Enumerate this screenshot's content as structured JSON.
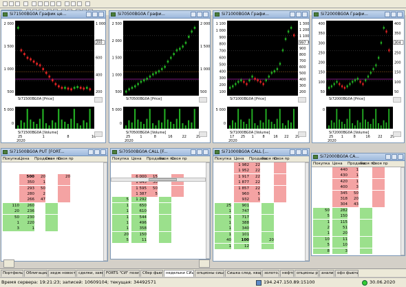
{
  "toolbar": {
    "timeframe": "M5"
  },
  "chart_windows": [
    {
      "title": "Si71500BG0A График це...",
      "price_label": "Si71500BG0A [Price]",
      "volume_label": "Si71500BG0A [Volume]",
      "price_ticks_left": [
        "2 000",
        "1 500",
        "1 000",
        "500"
      ],
      "price_ticks_right": [
        "1 000",
        "800",
        "600",
        "400",
        "200"
      ],
      "volume_ticks": [
        "5 000",
        "0"
      ],
      "last_value": "200",
      "date_labels": [
        "25",
        "1",
        "8",
        "16"
      ],
      "date_row2": [
        "2020"
      ]
    },
    {
      "title": "Si70500BG0A Графи...",
      "price_label": "Si70500BG0A [Price]",
      "volume_label": "Si70500BG0A [Volume]",
      "price_ticks_left": [
        "2 500",
        "2 000",
        "1 500",
        "1 000",
        "500"
      ],
      "price_ticks_right": [
        "2 000",
        "1 500",
        "1 000",
        "500"
      ],
      "volume_ticks": [
        "5 000",
        "0"
      ],
      "date_labels": [
        "25",
        "1",
        "8",
        "16",
        "22",
        "29"
      ],
      "date_row2": [
        "2020"
      ]
    },
    {
      "title": "Si71000BG0A Графи...",
      "price_label": "Si71000BG0A [Price]",
      "volume_label": "Si71000BG0A [Volume]",
      "price_ticks_left": [
        "1 100",
        "1 000",
        "900",
        "800",
        "700",
        "600",
        "500",
        "400",
        "300",
        "200",
        "100"
      ],
      "price_ticks_right": [
        "1 300",
        "1 200",
        "1 100",
        "1 000",
        "900",
        "800",
        "700",
        "600",
        "500",
        "400",
        "300",
        "200"
      ],
      "last_value": "997",
      "volume_ticks": [
        "5 000",
        "0"
      ],
      "date_labels": [
        "17",
        "25",
        "1",
        "8",
        "16",
        "22",
        "29"
      ],
      "date_row2": [
        "2020"
      ]
    },
    {
      "title": "Si72000BG0A Графи...",
      "price_label": "Si72000BG0A [Price]",
      "volume_label": "Si72000BG0A [Volume]",
      "price_ticks_left": [
        "400",
        "350",
        "300",
        "250",
        "200",
        "150",
        "100",
        "50"
      ],
      "price_ticks_right": [
        "400",
        "350",
        "300",
        "250",
        "200",
        "150",
        "100",
        "50"
      ],
      "last_value": "304",
      "volume_ticks": [
        "0"
      ],
      "date_labels": [
        "25",
        "1",
        "8",
        "16",
        "22",
        "29"
      ],
      "date_row2": [
        "2020"
      ]
    }
  ],
  "book_windows": [
    {
      "title": "Si71500BG0A PUT [FORT...",
      "headers": [
        "Покупка",
        "Цена",
        "Продажа",
        "Своя по",
        "Своя пр"
      ],
      "rows": [
        {
          "buy": "",
          "price": "",
          "sell": "",
          "own_buy": "",
          "own_sell": "",
          "side": "none"
        },
        {
          "buy": "",
          "price": "",
          "sell": "",
          "own_buy": "",
          "own_sell": "",
          "side": "none"
        },
        {
          "buy": "",
          "price": "500",
          "sell": "20",
          "own_buy": "",
          "own_sell": "20",
          "side": "ask"
        },
        {
          "buy": "",
          "price": "350",
          "sell": "1",
          "own_buy": "",
          "own_sell": "",
          "side": "ask"
        },
        {
          "buy": "",
          "price": "293",
          "sell": "50",
          "own_buy": "",
          "own_sell": "",
          "side": "ask"
        },
        {
          "buy": "",
          "price": "280",
          "sell": "2",
          "own_buy": "",
          "own_sell": "",
          "side": "ask"
        },
        {
          "buy": "",
          "price": "266",
          "sell": "47",
          "own_buy": "",
          "own_sell": "",
          "side": "ask"
        },
        {
          "buy": "110",
          "price": "260",
          "sell": "",
          "own_buy": "",
          "own_sell": "",
          "side": "bid"
        },
        {
          "buy": "20",
          "price": "236",
          "sell": "",
          "own_buy": "",
          "own_sell": "",
          "side": "bid"
        },
        {
          "buy": "50",
          "price": "230",
          "sell": "",
          "own_buy": "",
          "own_sell": "",
          "side": "bid"
        },
        {
          "buy": "1",
          "price": "220",
          "sell": "",
          "own_buy": "",
          "own_sell": "",
          "side": "bid"
        },
        {
          "buy": "3",
          "price": "1",
          "sell": "",
          "own_buy": "",
          "own_sell": "",
          "side": "bid"
        }
      ]
    },
    {
      "title": "Si70500BG0A CALL [F...",
      "headers": [
        "Покупка",
        "Цена",
        "Продажа",
        "Своя по",
        "Своя пр"
      ],
      "rows": [
        {
          "buy": "",
          "price": "",
          "sell": "",
          "own_buy": "",
          "own_sell": "",
          "side": "none"
        },
        {
          "buy": "",
          "price": "",
          "sell": "",
          "own_buy": "",
          "own_sell": "",
          "side": "none"
        },
        {
          "buy": "",
          "price": "6 000",
          "sell": "15",
          "own_buy": "",
          "own_sell": "",
          "side": "ask"
        },
        {
          "buy": "",
          "price": "1 645",
          "sell": "50",
          "own_buy": "",
          "own_sell": "",
          "side": "ask"
        },
        {
          "buy": "",
          "price": "1 595",
          "sell": "50",
          "own_buy": "",
          "own_sell": "",
          "side": "ask"
        },
        {
          "buy": "",
          "price": "1 387",
          "sell": "5",
          "own_buy": "",
          "own_sell": "",
          "side": "ask"
        },
        {
          "buy": "5",
          "price": "1 292",
          "sell": "",
          "own_buy": "",
          "own_sell": "",
          "side": "bid"
        },
        {
          "buy": "1",
          "price": "650",
          "sell": "",
          "own_buy": "",
          "own_sell": "",
          "side": "bid"
        },
        {
          "buy": "1",
          "price": "610",
          "sell": "",
          "own_buy": "",
          "own_sell": "",
          "side": "bid"
        },
        {
          "buy": "1",
          "price": "544",
          "sell": "",
          "own_buy": "",
          "own_sell": "",
          "side": "bid"
        },
        {
          "buy": "1",
          "price": "496",
          "sell": "",
          "own_buy": "",
          "own_sell": "",
          "side": "bid"
        },
        {
          "buy": "1",
          "price": "358",
          "sell": "",
          "own_buy": "",
          "own_sell": "",
          "side": "bid"
        },
        {
          "buy": "20",
          "price": "150",
          "sell": "",
          "own_buy": "",
          "own_sell": "",
          "side": "bid"
        },
        {
          "buy": "5",
          "price": "11",
          "sell": "",
          "own_buy": "",
          "own_sell": "",
          "side": "bid"
        }
      ]
    },
    {
      "title": "Si71000BG0A CALL [...",
      "headers": [
        "Покупка",
        "Цена",
        "Продажа",
        "Своя по",
        "Своя пр"
      ],
      "rows": [
        {
          "buy": "",
          "price": "1 982",
          "sell": "22",
          "own_buy": "",
          "own_sell": "",
          "side": "ask"
        },
        {
          "buy": "",
          "price": "1 952",
          "sell": "22",
          "own_buy": "",
          "own_sell": "",
          "side": "ask"
        },
        {
          "buy": "",
          "price": "1 917",
          "sell": "22",
          "own_buy": "",
          "own_sell": "",
          "side": "ask"
        },
        {
          "buy": "",
          "price": "1 877",
          "sell": "22",
          "own_buy": "",
          "own_sell": "",
          "side": "ask"
        },
        {
          "buy": "",
          "price": "1 857",
          "sell": "22",
          "own_buy": "",
          "own_sell": "",
          "side": "ask"
        },
        {
          "buy": "",
          "price": "960",
          "sell": "5",
          "own_buy": "",
          "own_sell": "",
          "side": "ask"
        },
        {
          "buy": "",
          "price": "932",
          "sell": "1",
          "own_buy": "",
          "own_sell": "",
          "side": "ask"
        },
        {
          "buy": "25",
          "price": "901",
          "sell": "",
          "own_buy": "",
          "own_sell": "",
          "side": "bid"
        },
        {
          "buy": "1",
          "price": "747",
          "sell": "",
          "own_buy": "",
          "own_sell": "",
          "side": "bid"
        },
        {
          "buy": "1",
          "price": "717",
          "sell": "",
          "own_buy": "",
          "own_sell": "",
          "side": "bid"
        },
        {
          "buy": "1",
          "price": "388",
          "sell": "",
          "own_buy": "",
          "own_sell": "",
          "side": "bid"
        },
        {
          "buy": "1",
          "price": "340",
          "sell": "",
          "own_buy": "",
          "own_sell": "",
          "side": "bid"
        },
        {
          "buy": "1",
          "price": "101",
          "sell": "",
          "own_buy": "",
          "own_sell": "",
          "side": "bid"
        },
        {
          "buy": "40",
          "price": "100",
          "sell": "",
          "own_buy": "20",
          "own_sell": "",
          "side": "bid"
        },
        {
          "buy": "1",
          "price": "12",
          "sell": "",
          "own_buy": "",
          "own_sell": "",
          "side": "bid"
        }
      ]
    },
    {
      "title": "Si72000BG0A CA...",
      "headers": [
        "Покупка",
        "Цена",
        "Продажа",
        "Своя по",
        "Своя пр"
      ],
      "rows": [
        {
          "buy": "",
          "price": "440",
          "sell": "1",
          "own_buy": "",
          "own_sell": "",
          "side": "ask"
        },
        {
          "buy": "",
          "price": "430",
          "sell": "1",
          "own_buy": "",
          "own_sell": "",
          "side": "ask"
        },
        {
          "buy": "",
          "price": "420",
          "sell": "1",
          "own_buy": "",
          "own_sell": "",
          "side": "ask"
        },
        {
          "buy": "",
          "price": "400",
          "sell": "3",
          "own_buy": "",
          "own_sell": "",
          "side": "ask"
        },
        {
          "buy": "",
          "price": "345",
          "sell": "50",
          "own_buy": "",
          "own_sell": "",
          "side": "ask"
        },
        {
          "buy": "",
          "price": "318",
          "sell": "20",
          "own_buy": "",
          "own_sell": "",
          "side": "ask"
        },
        {
          "buy": "",
          "price": "304",
          "sell": "43",
          "own_buy": "",
          "own_sell": "",
          "side": "ask"
        },
        {
          "buy": "50",
          "price": "282",
          "sell": "",
          "own_buy": "",
          "own_sell": "",
          "side": "bid"
        },
        {
          "buy": "5",
          "price": "150",
          "sell": "",
          "own_buy": "",
          "own_sell": "",
          "side": "bid"
        },
        {
          "buy": "1",
          "price": "115",
          "sell": "",
          "own_buy": "",
          "own_sell": "",
          "side": "bid"
        },
        {
          "buy": "2",
          "price": "51",
          "sell": "",
          "own_buy": "",
          "own_sell": "",
          "side": "bid"
        },
        {
          "buy": "1",
          "price": "20",
          "sell": "",
          "own_buy": "",
          "own_sell": "",
          "side": "bid"
        },
        {
          "buy": "10",
          "price": "11",
          "sell": "",
          "own_buy": "",
          "own_sell": "",
          "side": "bid"
        },
        {
          "buy": "5",
          "price": "10",
          "sell": "",
          "own_buy": "",
          "own_sell": "",
          "side": "bid"
        },
        {
          "buy": "8",
          "price": "3",
          "sell": "",
          "own_buy": "",
          "own_sell": "",
          "side": "bid"
        }
      ]
    }
  ],
  "tabs": [
    "Портфель",
    "Облигации",
    "хедж новости",
    "сделки, заявки",
    "FORTS \"СИ\" позици..",
    "Сбер фьючи",
    "недельки СИшка",
    "опционы сишка",
    "Сишка след. квартал",
    "золото.",
    "нефть",
    "опционы ртс",
    "анализ",
    "офз фьючи"
  ],
  "active_tab": 6,
  "status": {
    "left": "Время сервера: 19:21:23; записей: 10609104; текущая: 34492571",
    "connection": "194.247.150.89:15100",
    "date": "30.06.2020"
  },
  "colors": {
    "ask": "#f4a3a3",
    "bid": "#9be08c",
    "ask_text": "#5a0000",
    "bid_text": "#003300",
    "price_line": "#000000",
    "bull_candle": "#22aa22",
    "bear_candle": "#dd2222",
    "volume_bar": "#22aa22",
    "level_line": "#aa22aa"
  }
}
